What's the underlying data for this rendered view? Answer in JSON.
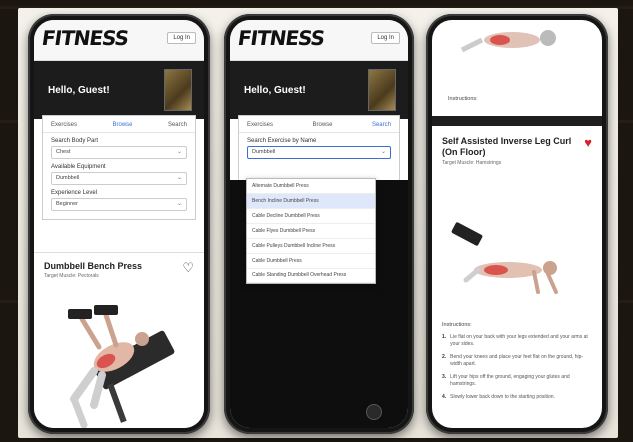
{
  "brand": {
    "logo": "FITNESS",
    "login": "Log In"
  },
  "greeting": "Hello, Guest!",
  "tabs": [
    "Exercises",
    "Browse",
    "Search"
  ],
  "form": {
    "field1_label": "Search Body Part",
    "field1_value": "Chest",
    "field2_label": "Available Equipment",
    "field2_value": "Dumbbell",
    "field3_label": "Experience Level",
    "field3_value": "Beginner"
  },
  "card1": {
    "title": "Dumbbell Bench Press",
    "sub": "Target Muscle: Pectorals"
  },
  "phone2": {
    "field_label": "Search Exercise by Name",
    "field_value": "Dumbbell",
    "dropdown": [
      "Alternate Dumbbell Press",
      "Bench Incline Dumbbell Press",
      "Cable Decline Dumbbell Press",
      "Cable Flyes Dumbbell Press",
      "Cable Pulleys Dumbbell Incline Press",
      "Cable Dumbbell Press",
      "Cable Standing Dumbbell Overhead Press"
    ],
    "selected_index": 1
  },
  "card2": {
    "title": "Self Assisted Inverse Leg Curl (On Floor)",
    "sub": "Target Muscle: Hamstrings",
    "instructions_label": "Instructions:",
    "steps": [
      "Lie flat on your back with your legs extended and your arms at your sides.",
      "Bend your knees and place your feet flat on the ground, hip-width apart.",
      "Lift your hips off the ground, engaging your glutes and hamstrings.",
      "Slowly lower back down to the starting position."
    ]
  },
  "colors": {
    "accent": "#3b6fd6",
    "heart_red": "#d3222a",
    "frame": "#f4f1ea"
  }
}
